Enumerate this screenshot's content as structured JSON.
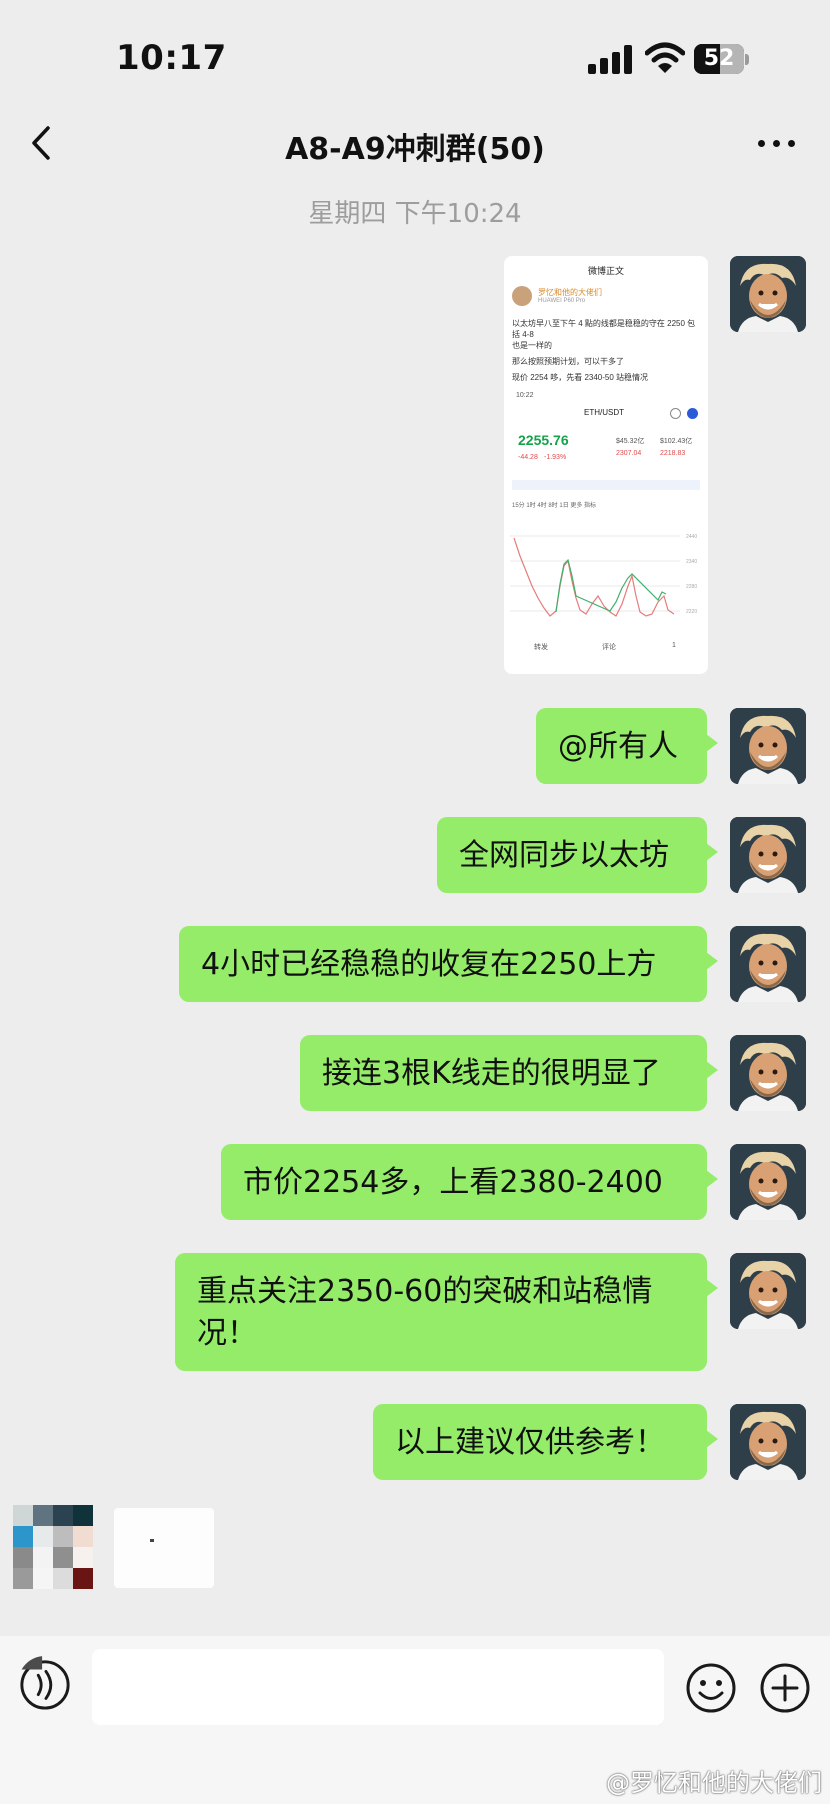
{
  "status_bar": {
    "time": "10:17",
    "battery": "52",
    "battery_level": 0.52
  },
  "header": {
    "title": "A8-A9冲刺群(50)"
  },
  "chat": {
    "timestamp": "星期四 下午10:24",
    "shared_screenshot": {
      "header": "微博正文",
      "user": "罗忆和他的大佬们",
      "meta": "HUAWEI P60 Pro",
      "line1": "以太坊早八至下午 4 點的线都是稳稳的守在 2250 包括 4-8",
      "line2": "也是一样的",
      "line3": "那么按照预期计划，可以干多了",
      "line4": "现价 2254 哆，先看 2340-50 站稳情况",
      "time": "10:22",
      "pair": "ETH/USDT",
      "price": "2255.76",
      "change1": "-44.28",
      "change2": "-1.93%",
      "stat1": "$45.32亿",
      "stat2": "$102.43亿",
      "stat3": "2307.04",
      "stat4": "2218.83",
      "tabs": "15分   1时   4时   8时   1日   更多   指标",
      "actions": [
        "转发",
        "评论",
        "1"
      ]
    },
    "messages": [
      {
        "text": "@所有人"
      },
      {
        "text": "全网同步以太坊"
      },
      {
        "text": "4小时已经稳稳的收复在2250上方"
      },
      {
        "text": "接连3根K线走的很明显了"
      },
      {
        "text": "市价2254多，上看2380-2400"
      },
      {
        "text": "重点关注2350-60的突破和站稳情况！"
      },
      {
        "text": "以上建议仅供参考！"
      }
    ]
  },
  "watermark": "@罗忆和他的大佬们",
  "icons": {
    "back": "chevron-left-icon",
    "more": "more-dots-icon",
    "voice": "voice-icon",
    "emoji": "emoji-icon",
    "plus": "plus-icon"
  },
  "colors": {
    "bubble": "#95ec69",
    "background": "#ededed"
  }
}
